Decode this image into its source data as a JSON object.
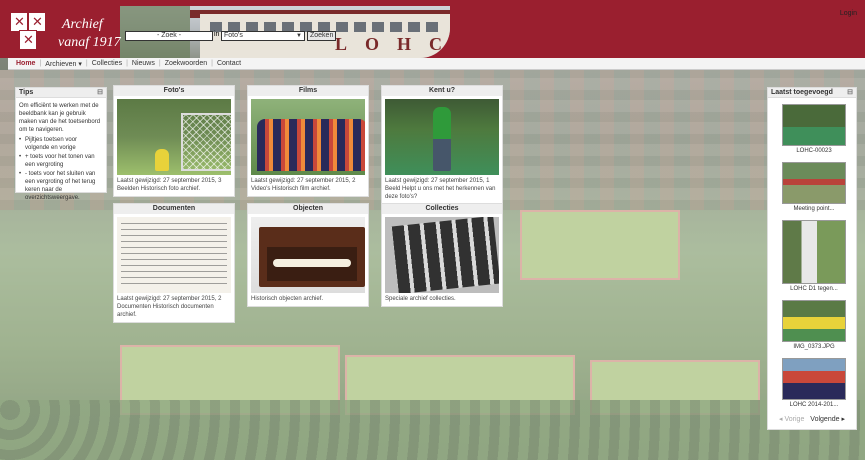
{
  "header": {
    "title_line1": "Archief",
    "title_line2": "vanaf 1917",
    "banner_text": "LOHC",
    "login_label": "Login",
    "search_placeholder": "- Zoek -",
    "search_in_label": "in",
    "search_category": "Foto's",
    "search_button": "Zoeken"
  },
  "nav": {
    "items": [
      "Home",
      "Archieven",
      "Collecties",
      "Nieuws",
      "Zoekwoorden",
      "Contact"
    ],
    "archieven_arrow": "▾"
  },
  "tips": {
    "title": "Tips",
    "toggle": "⊟",
    "intro": "Om efficiënt te werken met de beeldbank kan je gebruik maken van de het toetsenbord om te navigeren.",
    "items": [
      "Pijltjes toetsen voor volgende en vorige",
      "+ toets voor het tonen van een vergroting",
      "- toets voor het sluiten van een vergroting of het terug keren naar de overzichtsweergave."
    ]
  },
  "cards": [
    {
      "title": "Foto's",
      "meta": "Laatst gewijzigd: 27 september 2015, 3 Beelden Historisch foto archief."
    },
    {
      "title": "Films",
      "meta": "Laatst gewijzigd: 27 september 2015, 2 Video's Historisch film archief."
    },
    {
      "title": "Kent u?",
      "meta": "Laatst gewijzigd: 27 september 2015, 1 Beeld Helpt u ons met het herkennen van deze foto's?"
    },
    {
      "title": "Documenten",
      "meta": "Laatst gewijzigd: 27 september 2015, 2 Documenten Historisch documenten archief."
    },
    {
      "title": "Objecten",
      "meta": "Historisch objecten archief."
    },
    {
      "title": "Collecties",
      "meta": "Speciale archief collecties."
    }
  ],
  "recent": {
    "title": "Laatst toegevoegd",
    "toggle": "⊟",
    "items": [
      {
        "caption": "LOHC-00023"
      },
      {
        "caption": "Meeting point..."
      },
      {
        "caption": "LOHC D1 tegen..."
      },
      {
        "caption": "IMG_0373.JPG"
      },
      {
        "caption": "LOHC 2014-201..."
      }
    ],
    "prev_label": "◂ Vorige",
    "next_label": "Volgende ▸"
  },
  "colors": {
    "brand": "#9a1f2f",
    "panel": "#ffffff"
  }
}
